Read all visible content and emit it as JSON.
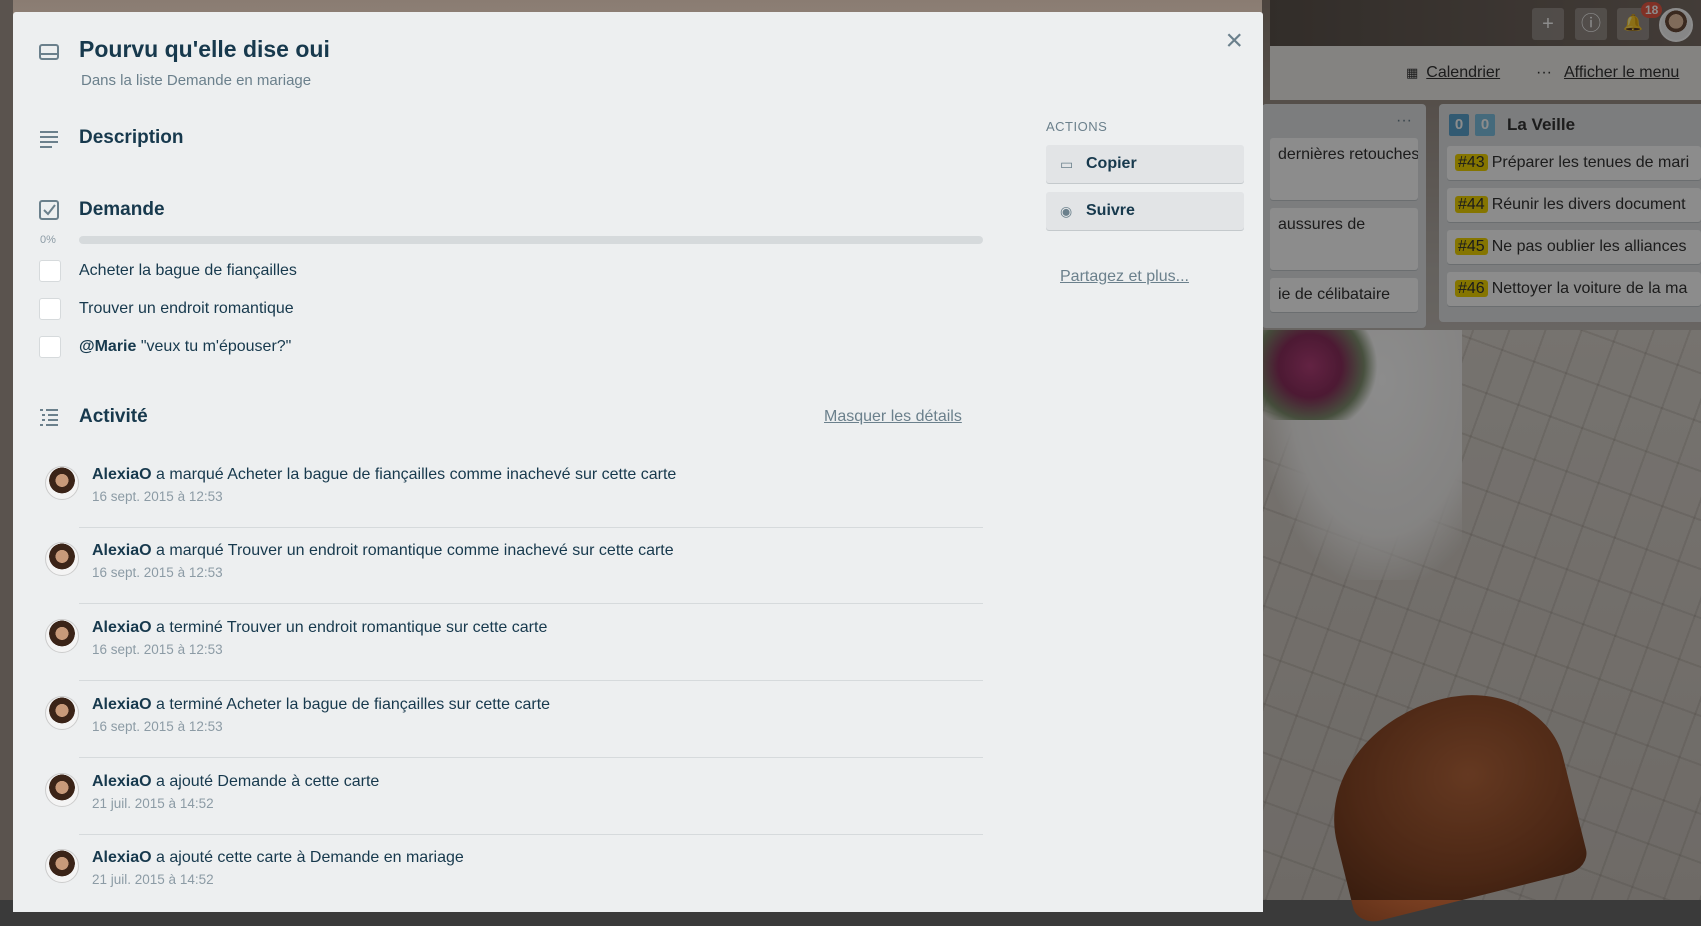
{
  "board": {
    "header_links": {
      "calendar": "Calendrier",
      "menu_dots": "···",
      "show_menu": "Afficher le menu"
    },
    "header_buttons": {
      "add": "+",
      "info": "ⓘ",
      "notifications": "🔔"
    },
    "notification_count": "18",
    "list_left": {
      "dots": "···",
      "cards": [
        "dernières retouches",
        "aussures de",
        "ie de célibataire"
      ]
    },
    "list_right": {
      "title": "La Veille",
      "badge_a": "0",
      "badge_b": "0",
      "cards": [
        {
          "tag": "#43",
          "text": "Préparer les tenues de mari"
        },
        {
          "tag": "#44",
          "text": "Réunir les divers document"
        },
        {
          "tag": "#45",
          "text": "Ne pas oublier les alliances"
        },
        {
          "tag": "#46",
          "text": "Nettoyer la voiture de la ma"
        }
      ]
    }
  },
  "card": {
    "title": "Pourvu qu'elle dise oui",
    "subtitle": "Dans la liste Demande en mariage",
    "close": "×"
  },
  "description": {
    "title": "Description"
  },
  "checklist": {
    "title": "Demande",
    "progress_label": "0%",
    "progress": 0,
    "items": [
      {
        "mention": "",
        "text": "Acheter la bague de fiançailles"
      },
      {
        "mention": "",
        "text": "Trouver un endroit romantique"
      },
      {
        "mention": "@Marie",
        "text": " \"veux tu m'épouser?\""
      }
    ]
  },
  "activity": {
    "title": "Activité",
    "hide_details": "Masquer les détails",
    "entries": [
      {
        "user": "AlexiaO",
        "text": " a marqué Acheter la bague de fiançailles comme inachevé sur cette carte",
        "date": "16 sept. 2015 à 12:53"
      },
      {
        "user": "AlexiaO",
        "text": " a marqué Trouver un endroit romantique comme inachevé sur cette carte",
        "date": "16 sept. 2015 à 12:53"
      },
      {
        "user": "AlexiaO",
        "text": " a terminé Trouver un endroit romantique sur cette carte",
        "date": "16 sept. 2015 à 12:53"
      },
      {
        "user": "AlexiaO",
        "text": " a terminé Acheter la bague de fiançailles sur cette carte",
        "date": "16 sept. 2015 à 12:53"
      },
      {
        "user": "AlexiaO",
        "text": " a ajouté Demande à cette carte",
        "date": "21 juil. 2015 à 14:52"
      },
      {
        "user": "AlexiaO",
        "text": " a ajouté cette carte à Demande en mariage",
        "date": "21 juil. 2015 à 14:52"
      }
    ]
  },
  "sidebar": {
    "actions_heading": "ACTIONS",
    "copy": "Copier",
    "follow": "Suivre",
    "share": "Partagez et plus..."
  },
  "colors": {
    "progress": "#5ba4cf",
    "label_yellow": "#f2d600",
    "badge_red": "#eb5a46",
    "badge_blue": "#5ba4cf"
  },
  "icons": [
    "card-icon",
    "description-icon",
    "checklist-icon",
    "activity-icon",
    "close-icon",
    "copy-icon",
    "eye-icon",
    "plus-icon",
    "info-icon",
    "bell-icon",
    "calendar-icon"
  ]
}
